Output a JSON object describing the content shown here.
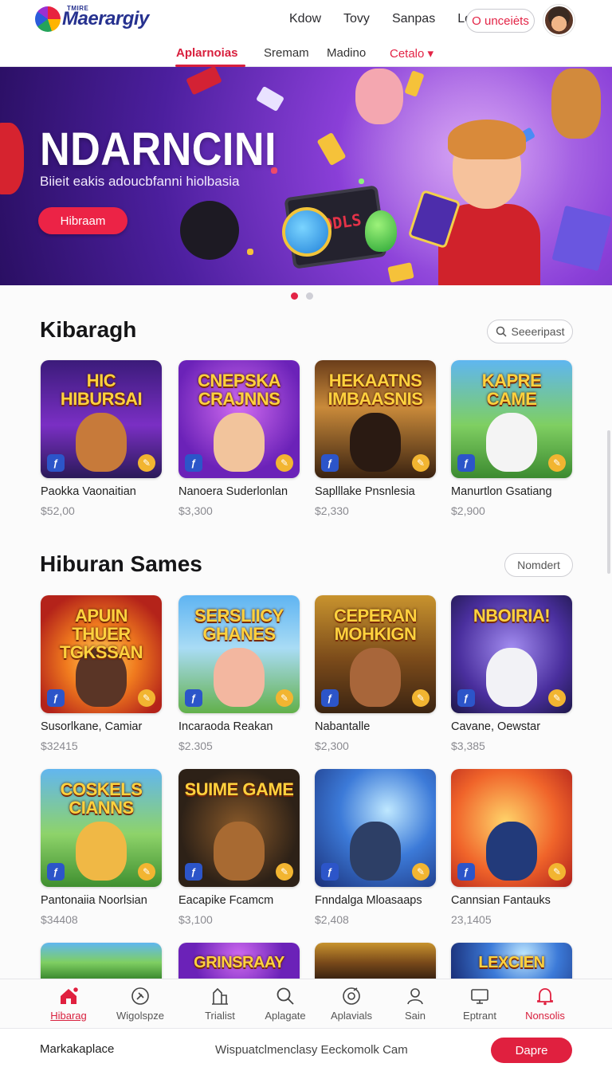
{
  "header": {
    "logo_small": "TMIRE",
    "logo_text": "Maerargiy",
    "nav": [
      "Kdow",
      "Tovy",
      "Sanpas",
      "Lovs"
    ],
    "login_label": "O unceiėts"
  },
  "subnav": {
    "tabs": [
      "Aplarnoias",
      "Sremam",
      "Madino",
      "Cetalo"
    ],
    "active": "Aplarnoias",
    "dropdown_glyph": "▾"
  },
  "hero": {
    "title": "NDARNCINI",
    "subtitle": "Biieit eakis adoucbfanni hiolbasia",
    "button_label": "Hibraam",
    "tablet_text": "ODLS",
    "slides": 2,
    "active_slide": 1
  },
  "section1": {
    "title": "Kibaragh",
    "search_label": "Seeeripast",
    "items": [
      {
        "thumb_title": "HIC HIBURSAI",
        "name": "Paokka Vaonaitian",
        "price": "$52,00",
        "theme": "city"
      },
      {
        "thumb_title": "CNEPSKA CRAJNNS",
        "name": "Nanoera Suderlonlan",
        "price": "$3,300",
        "theme": "purple"
      },
      {
        "thumb_title": "HEKAATNS IMBAASNIS",
        "name": "Saplllake Pnsnlesia",
        "price": "$2,330",
        "theme": "stadium"
      },
      {
        "thumb_title": "KAPRE CAME",
        "name": "Manurtlon Gsatiang",
        "price": "$2,900",
        "theme": "garden"
      }
    ]
  },
  "section2": {
    "title": "Hiburan Sames",
    "more_label": "Nomdert",
    "items": [
      {
        "thumb_title": "APUIN THUER TGKSSAN",
        "name": "Susorlkane, Camiar",
        "price": "$32415",
        "theme": "fire"
      },
      {
        "thumb_title": "SERSLIICY GHANES",
        "name": "Incaraoda Reakan",
        "price": "$2.305",
        "theme": "sky"
      },
      {
        "thumb_title": "CEPERAN MOHKIGN",
        "name": "Nabantalle",
        "price": "$2,300",
        "theme": "town"
      },
      {
        "thumb_title": "NBOIRIA!",
        "name": "Cavane, Oewstar",
        "price": "$3,385",
        "theme": "night"
      },
      {
        "thumb_title": "COSKELS CIANNS",
        "name": "Pantonaiia Noorlsian",
        "price": "$34408",
        "theme": "meadow"
      },
      {
        "thumb_title": "SUIME GAME",
        "name": "Eacapike Fcamcm",
        "price": "$3,100",
        "theme": "dark"
      },
      {
        "thumb_title": "",
        "name": "Fnndalga Mloasaaps",
        "price": "$2,408",
        "theme": "blaster"
      },
      {
        "thumb_title": "",
        "name": "Cannsian Fantauks",
        "price": "23,1405",
        "theme": "action"
      }
    ],
    "partial_titles": [
      "",
      "GRINSRAAY",
      "",
      "LEXCIEN"
    ]
  },
  "bottom_nav": [
    {
      "label": "Hibarag",
      "icon": "home-icon",
      "state": "active"
    },
    {
      "label": "Wigolspze",
      "icon": "compass-icon",
      "state": ""
    },
    {
      "label": "Trialist",
      "icon": "building-icon",
      "state": ""
    },
    {
      "label": "Aplagate",
      "icon": "search-icon",
      "state": ""
    },
    {
      "label": "Aplavials",
      "icon": "disc-icon",
      "state": ""
    },
    {
      "label": "Sain",
      "icon": "user-icon",
      "state": ""
    },
    {
      "label": "Eptrant",
      "icon": "monitor-icon",
      "state": ""
    },
    {
      "label": "Nonsolis",
      "icon": "bell-icon",
      "state": "alert"
    }
  ],
  "footer": {
    "left": "Markakaplace",
    "middle": "Wispuatclmenclasy Eeckomolk Cam",
    "button_label": "Dapre"
  },
  "colors": {
    "accent": "#e0203f",
    "hero_purple": "#8a3fd8",
    "brand_blue": "#26318f"
  }
}
